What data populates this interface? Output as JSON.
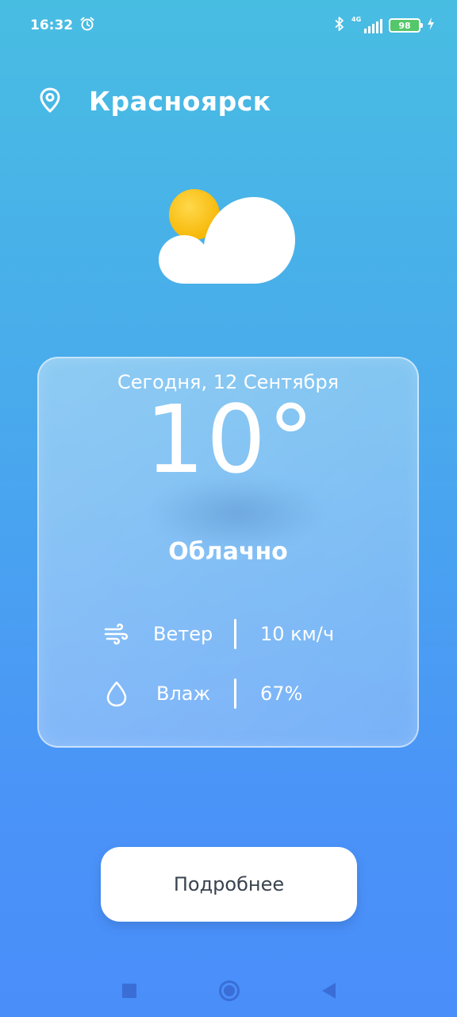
{
  "status_bar": {
    "time": "16:32",
    "network": "4G",
    "battery": "98"
  },
  "location": {
    "city": "Красноярск",
    "icon": "location-pin-icon"
  },
  "weather_icon": "partly-cloudy-icon",
  "today": {
    "date": "Сегодня, 12 Сентября",
    "temperature": "10°",
    "condition": "Облачно",
    "wind": {
      "label": "Ветер",
      "value": "10 км/ч",
      "icon": "wind-icon"
    },
    "humidity": {
      "label": "Влаж",
      "value": "67%",
      "icon": "drop-icon"
    }
  },
  "details_button": "Подробнее",
  "colors": {
    "background_top": "#48BDE2",
    "background_bottom": "#4A8EFA",
    "sun": "#FFC514",
    "button_text": "#3A4350"
  }
}
